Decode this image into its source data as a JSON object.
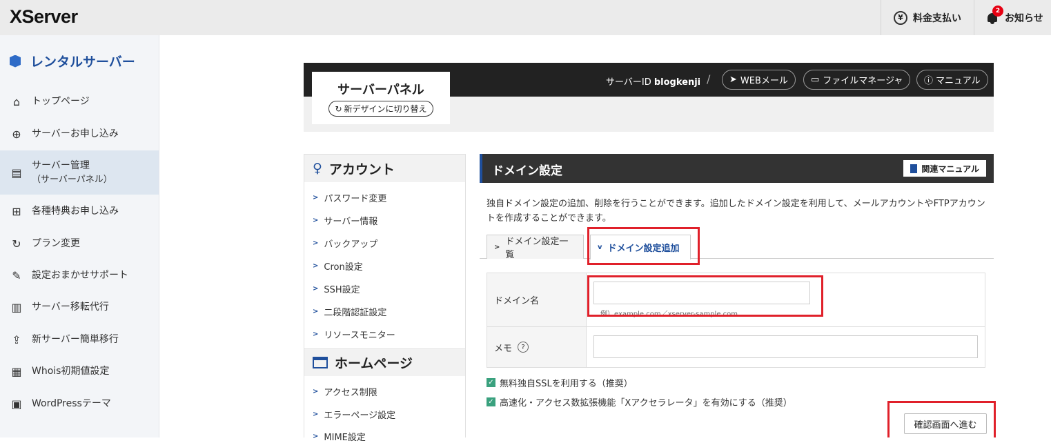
{
  "topbar": {
    "logo": "XServer",
    "pay_label": "料金支払い",
    "notice_label": "お知らせ",
    "notice_count": "2"
  },
  "sidebar": {
    "title": "レンタルサーバー",
    "items": [
      {
        "label": "トップページ",
        "icon": "home-icon",
        "glyph": "⌂"
      },
      {
        "label": "サーバーお申し込み",
        "icon": "plus-circle-icon",
        "glyph": "⊕"
      },
      {
        "label": "サーバー管理",
        "sub": "（サーバーパネル）",
        "icon": "server-icon",
        "glyph": "▤"
      },
      {
        "label": "各種特典お申し込み",
        "icon": "gift-icon",
        "glyph": "⊞"
      },
      {
        "label": "プラン変更",
        "icon": "refresh-icon",
        "glyph": "↻"
      },
      {
        "label": "設定おまかせサポート",
        "icon": "wrench-icon",
        "glyph": "✎"
      },
      {
        "label": "サーバー移転代行",
        "icon": "server-move-icon",
        "glyph": "▥"
      },
      {
        "label": "新サーバー簡単移行",
        "icon": "upload-icon",
        "glyph": "⇪"
      },
      {
        "label": "Whois初期値設定",
        "icon": "document-icon",
        "glyph": "▦"
      },
      {
        "label": "WordPressテーマ",
        "icon": "window-icon",
        "glyph": "▣"
      }
    ]
  },
  "panel": {
    "title": "サーバーパネル",
    "new_design": "新デザインに切り替え",
    "server_id_label": "サーバーID",
    "server_id": "blogkenji",
    "separator": "/",
    "webmail": "WEBメール",
    "file_manager": "ファイルマネージャ",
    "manual": "マニュアル"
  },
  "leftnav": {
    "account_title": "アカウント",
    "account_items": [
      "パスワード変更",
      "サーバー情報",
      "バックアップ",
      "Cron設定",
      "SSH設定",
      "二段階認証設定",
      "リソースモニター"
    ],
    "homepage_title": "ホームページ",
    "homepage_items": [
      "アクセス制限",
      "エラーページ設定",
      "MIME設定"
    ]
  },
  "main": {
    "title": "ドメイン設定",
    "manual_button": "関連マニュアル",
    "description": "独自ドメイン設定の追加、削除を行うことができます。追加したドメイン設定を利用して、メールアカウントやFTPアカウントを作成することができます。",
    "tabs": [
      {
        "label": "ドメイン設定一覧",
        "active": false
      },
      {
        "label": "ドメイン設定追加",
        "active": true
      }
    ],
    "form": {
      "domain_label": "ドメイン名",
      "domain_value": "",
      "domain_hint": "例）example.com／xserver-sample.com",
      "memo_label": "メモ",
      "memo_help": "?",
      "memo_value": ""
    },
    "checks": [
      {
        "label": "無料独自SSLを利用する（推奨）",
        "checked": true
      },
      {
        "label": "高速化・アクセス数拡張機能「Xアクセラレータ」を有効にする（推奨）",
        "checked": true
      }
    ],
    "confirm_button": "確認画面へ進む"
  }
}
